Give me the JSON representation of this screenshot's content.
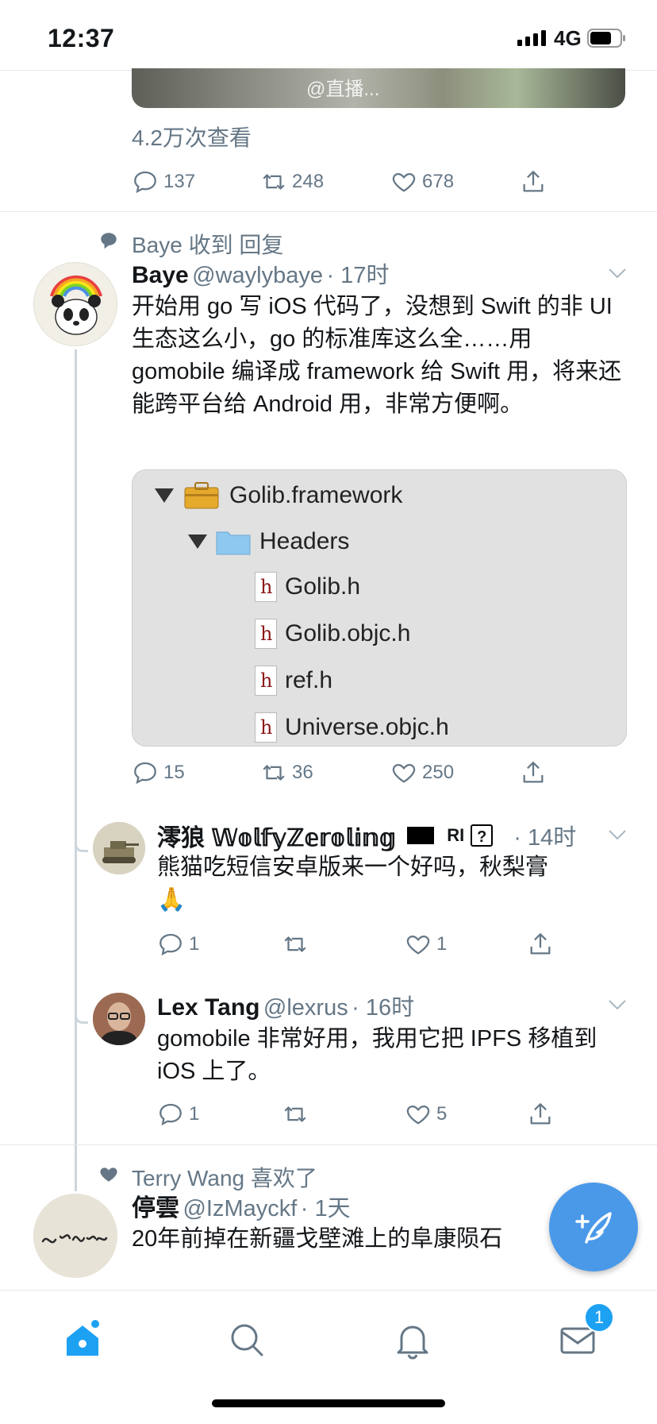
{
  "status": {
    "time": "12:37",
    "network": "4G"
  },
  "top_tweet": {
    "watermark": "@直播...",
    "views": "4.2万次查看",
    "replies": "137",
    "retweets": "248",
    "likes": "678"
  },
  "tweet1": {
    "context": "Baye 收到 回复",
    "name": "Baye",
    "handle": "@waylybaye",
    "time": "· 17时",
    "text": "开始用 go 写 iOS 代码了，没想到 Swift 的非 UI 生态这么小，go 的标准库这么全……用 gomobile 编译成 framework 给 Swift 用，将来还能跨平台给 Android 用，非常方便啊。",
    "files": {
      "framework": "Golib.framework",
      "folder": "Headers",
      "headers": [
        "Golib.h",
        "Golib.objc.h",
        "ref.h",
        "Universe.objc.h"
      ]
    },
    "replies": "15",
    "retweets": "36",
    "likes": "250"
  },
  "reply1": {
    "name": "澪狼 𝕎𝕠𝕝𝕗𝕪ℤ𝕖𝕣𝕠𝕝𝕚𝕟𝕘",
    "name_suffix": "RI",
    "time": "· 14时",
    "text": "熊猫吃短信安卓版来一个好吗，秋梨膏",
    "emoji": "🙏",
    "replies": "1",
    "retweets": "",
    "likes": "1"
  },
  "reply2": {
    "name": "Lex Tang",
    "handle": "@lexrus",
    "time": "· 16时",
    "text": "gomobile 非常好用，我用它把 IPFS 移植到 iOS 上了。",
    "replies": "1",
    "retweets": "",
    "likes": "5"
  },
  "tweet2": {
    "context": "Terry Wang 喜欢了",
    "name": "停雲",
    "handle": "@IzMayckf",
    "time": "· 1天",
    "text": "20年前掉在新疆戈壁滩上的阜康陨石"
  },
  "tabbar": {
    "messages_badge": "1"
  },
  "colors": {
    "accent": "#1da1f2",
    "fab": "#4a99e9",
    "meta": "#657786"
  }
}
